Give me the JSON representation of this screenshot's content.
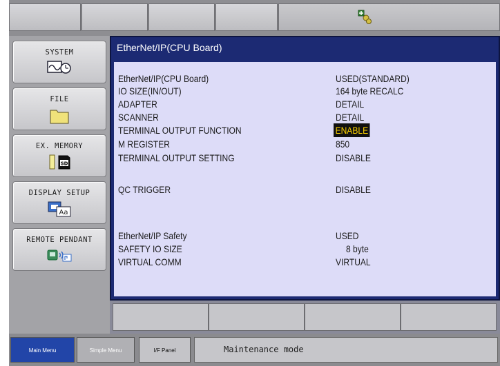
{
  "window": {
    "title": "EtherNet/IP(CPU Board)"
  },
  "side_menu": [
    {
      "label": "SYSTEM",
      "icon": "system-monitor-icon"
    },
    {
      "label": "FILE",
      "icon": "folder-icon"
    },
    {
      "label": "EX. MEMORY",
      "icon": "sd-card-icon"
    },
    {
      "label": "DISPLAY SETUP",
      "icon": "display-font-icon"
    },
    {
      "label": "REMOTE PENDANT",
      "icon": "remote-pendant-icon"
    }
  ],
  "settings": [
    {
      "label": "EtherNet/IP(CPU Board)",
      "value": "USED(STANDARD)"
    },
    {
      "label": "IO SIZE(IN/OUT)",
      "value": "164 byte RECALC"
    },
    {
      "label": "ADAPTER",
      "value": "DETAIL"
    },
    {
      "label": "SCANNER",
      "value": "DETAIL"
    },
    {
      "label": "TERMINAL OUTPUT FUNCTION",
      "value": "ENABLE",
      "selected": true
    },
    {
      "label": "M REGISTER",
      "value": "850"
    },
    {
      "label": "TERMINAL OUTPUT SETTING",
      "value": "DISABLE"
    },
    {
      "label": "QC TRIGGER",
      "value": "DISABLE"
    },
    {
      "label": "EtherNet/IP Safety",
      "value": "USED"
    },
    {
      "label": "SAFETY IO SIZE",
      "value": "8 byte"
    },
    {
      "label": "VIRTUAL COMM",
      "value": "VIRTUAL"
    }
  ],
  "bottom_bar": {
    "main_menu": "Main Menu",
    "simple_menu": "Simple Menu",
    "if_panel": "I/F Panel",
    "status_message": "Maintenance mode"
  },
  "colors": {
    "title_bar": "#1c2a73",
    "content_bg": "#dddcf8",
    "highlight_bg": "#111111",
    "highlight_fg": "#ffd400",
    "main_menu_active": "#2245a8"
  }
}
